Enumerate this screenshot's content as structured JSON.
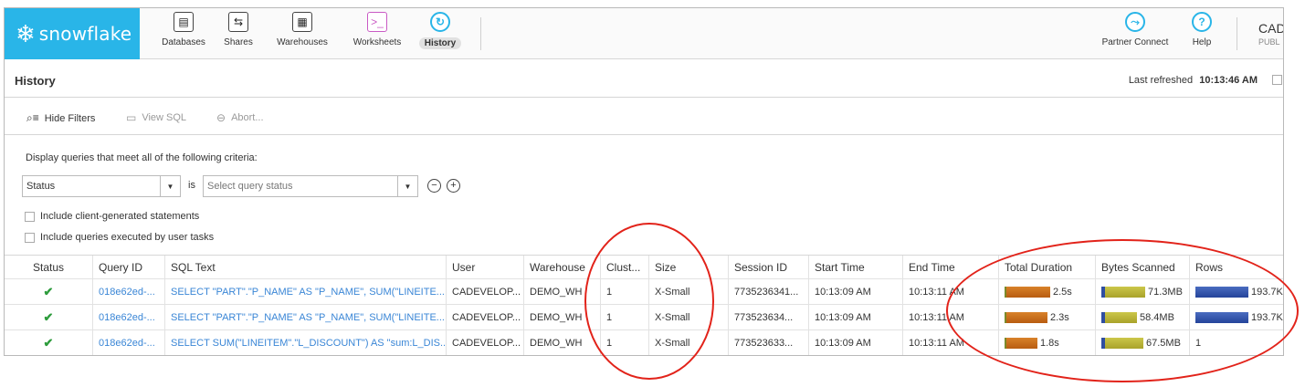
{
  "app": {
    "brand": "snowflake"
  },
  "nav": {
    "items": [
      {
        "label": "Databases",
        "icon": "database-icon",
        "glyph": "▤"
      },
      {
        "label": "Shares",
        "icon": "shares-icon",
        "glyph": "⇆"
      },
      {
        "label": "Warehouses",
        "icon": "warehouses-icon",
        "glyph": "▦"
      },
      {
        "label": "Worksheets",
        "icon": "worksheets-icon",
        "glyph": ">_"
      },
      {
        "label": "History",
        "icon": "history-icon",
        "glyph": "↻"
      }
    ],
    "active": "History",
    "right_items": [
      {
        "label": "Partner Connect",
        "icon": "partner-connect-icon",
        "glyph": "⤳"
      },
      {
        "label": "Help",
        "icon": "help-icon",
        "glyph": "?"
      }
    ],
    "user_name": "CAD",
    "user_role": "PUBL"
  },
  "page": {
    "title": "History",
    "last_refreshed_label": "Last refreshed",
    "last_refreshed_time": "10:13:46 AM"
  },
  "toolbar": {
    "hide_filters": "Hide Filters",
    "view_sql": "View SQL",
    "abort": "Abort..."
  },
  "filters": {
    "criteria_text": "Display queries that meet all of the following criteria:",
    "field_value": "Status",
    "operator": "is",
    "value_placeholder": "Select query status",
    "include_client": "Include client-generated statements",
    "include_tasks": "Include queries executed by user tasks"
  },
  "table": {
    "columns": [
      "Status",
      "Query ID",
      "SQL Text",
      "User",
      "Warehouse",
      "Clust...",
      "Size",
      "Session ID",
      "Start Time",
      "End Time",
      "Total Duration",
      "Bytes Scanned",
      "Rows"
    ],
    "rows": [
      {
        "query_id": "018e62ed-...",
        "sql": "SELECT \"PART\".\"P_NAME\" AS \"P_NAME\", SUM(\"LINEITE...",
        "user": "CADEVELOP...",
        "warehouse": "DEMO_WH",
        "cluster": "1",
        "size": "X-Small",
        "session": "7735236341...",
        "start": "10:13:09 AM",
        "end": "10:13:11 AM",
        "duration": "2.5s",
        "duration_frac": 0.96,
        "bytes": "71.3MB",
        "bytes_frac": 1.0,
        "rows": "193.7K",
        "rows_frac": 1.0
      },
      {
        "query_id": "018e62ed-...",
        "sql": "SELECT \"PART\".\"P_NAME\" AS \"P_NAME\", SUM(\"LINEITE...",
        "user": "CADEVELOP...",
        "warehouse": "DEMO_WH",
        "cluster": "1",
        "size": "X-Small",
        "session": "773523634...",
        "start": "10:13:09 AM",
        "end": "10:13:11 AM",
        "duration": "2.3s",
        "duration_frac": 0.9,
        "bytes": "58.4MB",
        "bytes_frac": 0.82,
        "rows": "193.7K",
        "rows_frac": 1.0
      },
      {
        "query_id": "018e62ed-...",
        "sql": "SELECT SUM(\"LINEITEM\".\"L_DISCOUNT\") AS \"sum:L_DIS...",
        "user": "CADEVELOP...",
        "warehouse": "DEMO_WH",
        "cluster": "1",
        "size": "X-Small",
        "session": "773523633...",
        "start": "10:13:09 AM",
        "end": "10:13:11 AM",
        "duration": "1.8s",
        "duration_frac": 0.7,
        "bytes": "67.5MB",
        "bytes_frac": 0.95,
        "rows": "1",
        "rows_frac": 0
      }
    ]
  },
  "colors": {
    "brand": "#29b5e8",
    "link": "#3a86d6",
    "success": "#2e9c3d",
    "annotation": "#e2231a"
  }
}
